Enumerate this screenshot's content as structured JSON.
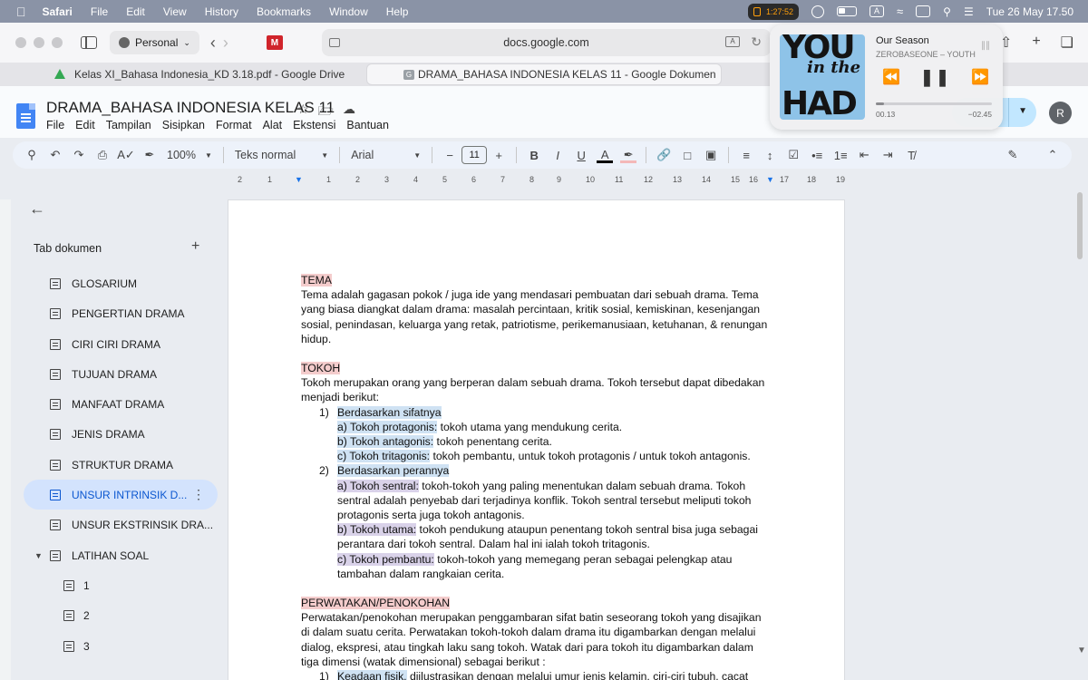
{
  "menubar": {
    "app": "Safari",
    "items": [
      "File",
      "Edit",
      "View",
      "History",
      "Bookmarks",
      "Window",
      "Help"
    ],
    "rec_time": "1:27:52",
    "date_time": "Tue 26 May  17.50",
    "input_badge": "A"
  },
  "browser": {
    "profile": "Personal",
    "url": "docs.google.com",
    "tabs": [
      {
        "title": "Kelas XI_Bahasa Indonesia_KD 3.18.pdf - Google Drive"
      },
      {
        "title": "DRAMA_BAHASA INDONESIA KELAS 11 - Google Dokumen"
      }
    ]
  },
  "docs": {
    "title": "DRAMA_BAHASA INDONESIA KELAS 11",
    "menu": [
      "File",
      "Edit",
      "Tampilan",
      "Sisipkan",
      "Format",
      "Alat",
      "Ekstensi",
      "Bantuan"
    ],
    "avatar_initial": "R",
    "toolbar": {
      "zoom": "100%",
      "style": "Teks normal",
      "font": "Arial",
      "font_size": "11"
    },
    "colors": {
      "accent": "#0b57d0",
      "heading_highlight": "#f4cccc",
      "blue_highlight": "#cfe2f3",
      "purple_highlight": "#d9d2e9"
    }
  },
  "ruler": [
    "2",
    "1",
    "1",
    "2",
    "3",
    "4",
    "5",
    "6",
    "7",
    "8",
    "9",
    "10",
    "11",
    "12",
    "13",
    "14",
    "15",
    "16",
    "17",
    "18",
    "19"
  ],
  "sidebar": {
    "heading": "Tab dokumen",
    "items": [
      {
        "label": "GLOSARIUM"
      },
      {
        "label": "PENGERTIAN DRAMA"
      },
      {
        "label": "CIRI CIRI DRAMA"
      },
      {
        "label": "TUJUAN DRAMA"
      },
      {
        "label": "MANFAAT DRAMA"
      },
      {
        "label": "JENIS DRAMA"
      },
      {
        "label": "STRUKTUR DRAMA"
      },
      {
        "label": "UNSUR INTRINSIK D..."
      },
      {
        "label": "UNSUR EKSTRINSIK DRA..."
      },
      {
        "label": "LATIHAN SOAL"
      },
      {
        "label": "1"
      },
      {
        "label": "2"
      },
      {
        "label": "3"
      }
    ]
  },
  "document": {
    "tema_heading": "TEMA",
    "tema_text": "Tema adalah gagasan pokok / juga ide yang mendasari pembuatan dari sebuah drama. Tema yang biasa diangkat dalam drama: masalah percintaan, kritik sosial, kemiskinan, kesenjangan sosial, penindasan, keluarga yang retak, patriotisme, perikemanusiaan, ketuhanan, & renungan hidup.",
    "tokoh_heading": "TOKOH",
    "tokoh_text": "Tokoh merupakan orang yang berperan dalam sebuah drama. Tokoh tersebut dapat dibedakan menjadi berikut:",
    "list1_num": "1)",
    "list1_title": "Berdasarkan sifatnya",
    "a_label": "a) Tokoh protagonis:",
    "a_text": " tokoh utama yang mendukung cerita.",
    "b_label": "b) Tokoh antagonis:",
    "b_text": " tokoh penentang cerita.",
    "c_label": "c) Tokoh tritagonis:",
    "c_text": " tokoh pembantu, untuk tokoh protagonis / untuk tokoh antagonis.",
    "list2_num": "2)",
    "list2_title": "Berdasarkan perannya",
    "a2_label": "a) Tokoh sentral:",
    "a2_text": " tokoh-tokoh yang paling menentukan dalam sebuah drama. Tokoh sentral adalah penyebab dari terjadinya konflik. Tokoh sentral tersebut meliputi tokoh protagonis serta juga tokoh antagonis.",
    "b2_label": "b) Tokoh utama:",
    "b2_text": " tokoh pendukung ataupun penentang tokoh sentral bisa juga sebagai perantara dari tokoh sentral. Dalam hal ini ialah tokoh tritagonis.",
    "c2_label": "c) Tokoh pembantu:",
    "c2_text": " tokoh-tokoh yang memegang peran sebagai pelengkap atau tambahan dalam rangkaian cerita.",
    "perwatakan_heading": "PERWATAKAN/PENOKOHAN",
    "perwatakan_text": "Perwatakan/penokohan merupakan penggambaran sifat batin seseorang tokoh yang disajikan di dalam suatu cerita. Perwatakan tokoh-tokoh dalam drama itu digambarkan dengan melalui dialog, ekspresi, atau tingkah laku sang tokoh. Watak dari para tokoh itu digambarkan dalam tiga dimensi (watak dimensional) sebagai berikut :",
    "list3_num": "1)",
    "list3_title": "Keadaan fisik,",
    "list3_text": " diilustrasikan dengan melalui umur jenis kelamin, ciri-ciri tubuh, cacat"
  },
  "now_playing": {
    "song": "Our Season",
    "artist": "ZEROBASEONE – YOUTH",
    "elapsed": "00.13",
    "remaining": "−02.45",
    "progress": 0.07,
    "art_text": [
      "YOU",
      "in the",
      "HAD"
    ]
  }
}
